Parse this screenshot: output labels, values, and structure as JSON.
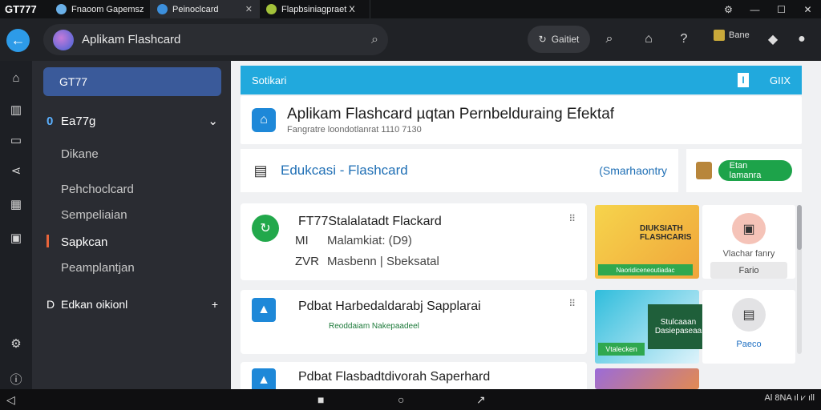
{
  "window": {
    "app_title": "GT777",
    "tabs": [
      {
        "label": "Fnaoom Gapemsz",
        "icon_color": "#6ab0e8"
      },
      {
        "label": "Peinoclcard",
        "icon_color": "#3c8fdc"
      },
      {
        "label": "Flapbsiniagpraet X",
        "icon_color": "#a3c23a"
      }
    ],
    "controls": [
      "minimize",
      "maximize",
      "close"
    ]
  },
  "topbar": {
    "search_text": "Aplikam Flashcard",
    "pill_label": "Gaitiet",
    "user_label": "Bane"
  },
  "sidebar": {
    "active_item": "GT77",
    "group1_num": "0",
    "group1_label": "Ea77g",
    "items": [
      "Dikane",
      "Pehchoclcard",
      "Sempeliaian",
      "Sapkcan",
      "Peamplantjan"
    ],
    "selected_index": 3,
    "group2_num": "D",
    "group2_label": "Edkan oikionl"
  },
  "main": {
    "banner_title": "Sotikari",
    "banner_right": "GIIX",
    "banner_info": "I",
    "header_title": "Aplikam Flashcard µqtan Pernbelduraing Efektaf",
    "header_sub": "Fangratre loondotlanrat 1110 7130",
    "category_title": "Edukcasi - Flashcard",
    "category_right": "(Smarhaontry",
    "promo_button": "Etan lamanra",
    "cards": [
      {
        "title": "FT77Stalalatadt Flackard",
        "row1_key": "MI",
        "row1_val": "Malamkiat: (D9)",
        "row2_key": "ZVR",
        "row2_val": "Masbenn  |  Sbeksatal",
        "icon_color": "#22a84b"
      },
      {
        "title": "Pdbat Harbedaldarabj Sapplarai",
        "row1_key": "",
        "row1_val": "Reoddaiam  Nakepaadeel",
        "row2_key": "",
        "row2_val": "",
        "icon_color": "#1e88d8"
      },
      {
        "title": "Pdbat Flasbadtdivorah Saperhard",
        "row1_key": "",
        "row1_val": "",
        "row2_key": "",
        "row2_val": "",
        "icon_color": "#1e88d8"
      }
    ],
    "thumb1_text": "DIUKSIATH FLASHCARIS",
    "thumb1_bar": "Naoridiceneoutiadac",
    "thumb2_text": "Stulcaaan Dasiepaseaa",
    "thumb2_bar": "Vtalecken",
    "side_card1_caption": "Vlachar fanry",
    "side_card1_button": "Fario",
    "side_card2_link": "Paeco"
  },
  "sysbar": {
    "status": "Al 8NA  ıl  ⩗  ıll"
  }
}
